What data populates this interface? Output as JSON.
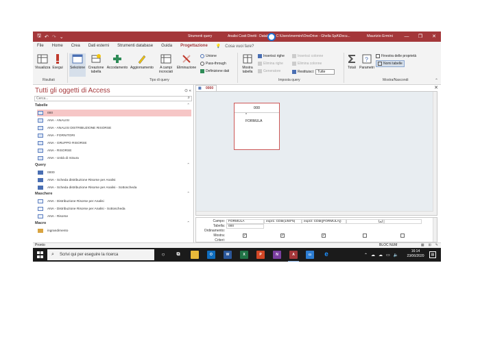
{
  "titlebar": {
    "context_label": "Strumenti query",
    "document": "Analisi Costi Diretti : Database- C:\\Users\\mermini\\OneDrive - Ghella SpA\\Docu...",
    "user": "Maurizio Ermini",
    "minimize": "—",
    "restore": "❐",
    "close": "✕"
  },
  "tabs": [
    "File",
    "Home",
    "Crea",
    "Dati esterni",
    "Strumenti database",
    "Guida",
    "Progettazione"
  ],
  "active_tab": "Progettazione",
  "tellme": "Cosa vuoi fare?",
  "ribbon": {
    "risultati": {
      "label": "Risultati",
      "visualizza": "Visualizza",
      "esegui": "Esegui"
    },
    "tipo_query": {
      "label": "Tipo di query",
      "selezione": "Selezione",
      "creazione_tabella": "Creazione tabella",
      "accodamento": "Accodamento",
      "aggiornamento": "Aggiornamento",
      "a_campi_incrociati": "A campi incrociati",
      "eliminazione": "Eliminazione",
      "unione": "Unione",
      "pass_through": "Pass-through",
      "definizione_dati": "Definizione dati"
    },
    "imposta_query": {
      "label": "Imposta query",
      "mostra_tabella": "Mostra tabella",
      "inserisci_righe": "Inserisci righe",
      "elimina_righe": "Elimina righe",
      "generatore": "Generatore",
      "inserisci_colonne": "Inserisci colonne",
      "elimina_colonne": "Elimina colonne",
      "restituisci": "Restituisci:",
      "restituisci_value": "Tutte"
    },
    "mostra_nascondi": {
      "label": "Mostra/Nascondi",
      "totali": "Totali",
      "parametri": "Parametri",
      "finestra_proprieta": "Finestra delle proprietà",
      "nomi_tabelle": "Nomi tabelle"
    }
  },
  "nav": {
    "title": "Tutti gli oggetti di Access",
    "search_placeholder": "Cerca...",
    "sections": [
      {
        "name": "Tabelle",
        "items": [
          "000",
          "ANA - ANALISI",
          "ANA - ANALISI DISTRIBUZIONE RISORSE",
          "ANA - FORNITORI",
          "ANA - GRUPPO RISORSE",
          "ANA - RISORSE",
          "ANA - Unità di misura"
        ]
      },
      {
        "name": "Query",
        "items": [
          "0000",
          "ANA - Scheda distribuzione Risorse per Analisi",
          "ANA - Scheda distribuzione Risorse per Analisi - Sottoscheda"
        ]
      },
      {
        "name": "Maschere",
        "items": [
          "ANA - Distribuzione Risorse per Analisi",
          "ANA - Distribuzione Risorse per Analisi - Sottoscheda",
          "ANA - Risorse"
        ]
      },
      {
        "name": "Macro",
        "items": [
          "ingrandimento"
        ]
      }
    ]
  },
  "document": {
    "tab_label": "0000",
    "table_name": "000",
    "table_star": "*",
    "table_field": "FORMULA"
  },
  "grid": {
    "labels": [
      "Campo:",
      "Tabella:",
      "Ordinamento:",
      "Mostra:",
      "Criteri:"
    ],
    "col1_field": "FORMULA",
    "col1_table": "000",
    "col2_field": "expr1: CDbl(1/50*5)",
    "col3_field": "expr2: CDbl([FORMULA])",
    "show": [
      true,
      true,
      true,
      false,
      false
    ]
  },
  "status": {
    "left": "Pronto",
    "right": "BLOC NUM"
  },
  "taskbar": {
    "search_placeholder": "Scrivi qui per eseguire la ricerca",
    "time": "16:14",
    "date": "23/06/2020"
  }
}
